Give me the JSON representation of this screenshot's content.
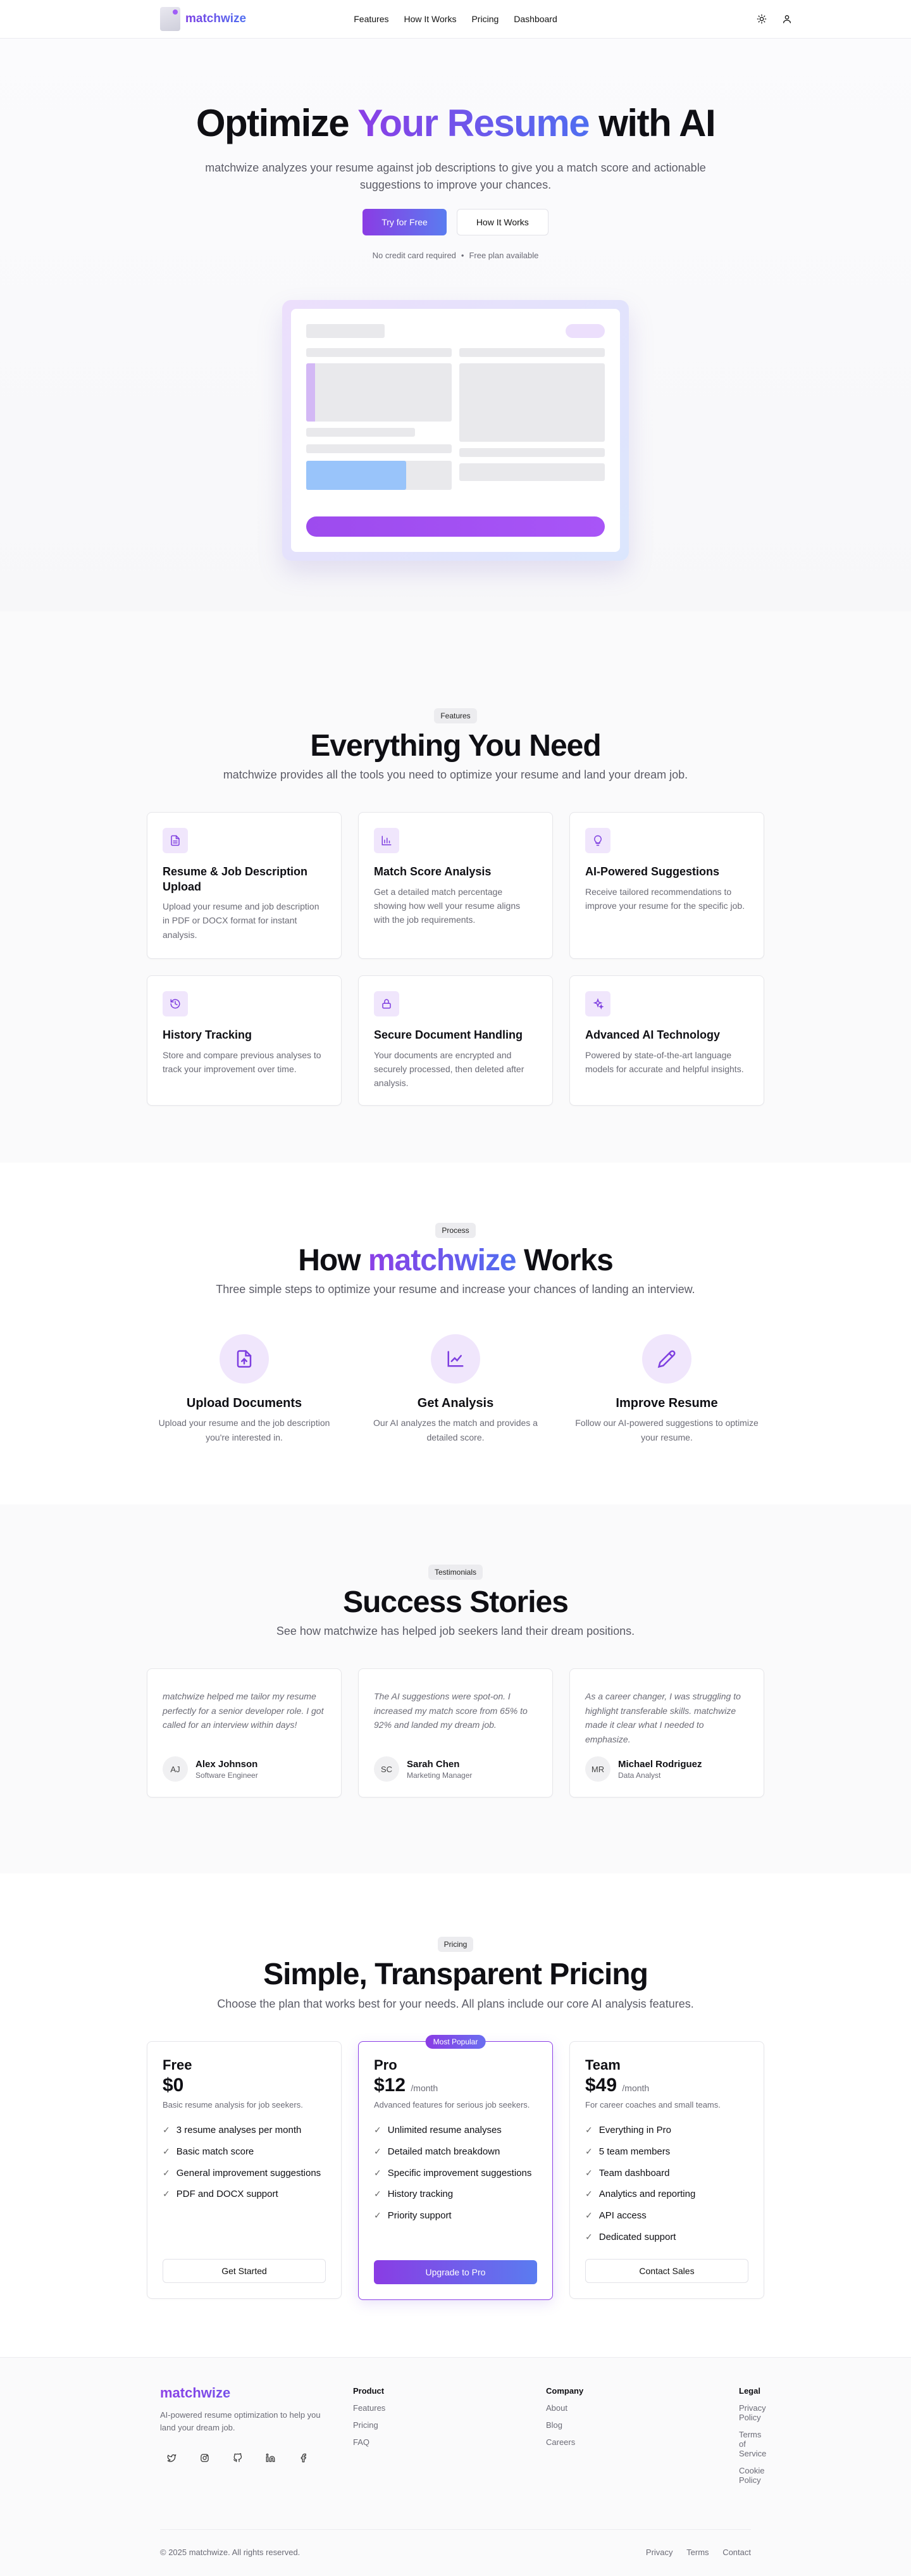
{
  "brand": {
    "name": "matchwize"
  },
  "nav": {
    "items": [
      "Features",
      "How It Works",
      "Pricing",
      "Dashboard"
    ]
  },
  "hero": {
    "title_pre": "Optimize ",
    "title_highlight": "Your Resume",
    "title_post": " with AI",
    "subtitle": "matchwize analyzes your resume against job descriptions to give you a match score and actionable suggestions to improve your chances.",
    "primary_cta": "Try for Free",
    "secondary_cta": "How It Works",
    "note_1": "No credit card required",
    "note_sep": "•",
    "note_2": "Free plan available"
  },
  "features": {
    "badge": "Features",
    "title": "Everything You Need",
    "lead": "matchwize provides all the tools you need to optimize your resume and land your dream job.",
    "items": [
      {
        "icon": "file-icon",
        "title": "Resume & Job Description Upload",
        "desc": "Upload your resume and job description in PDF or DOCX format for instant analysis."
      },
      {
        "icon": "chart-icon",
        "title": "Match Score Analysis",
        "desc": "Get a detailed match percentage showing how well your resume aligns with the job requirements."
      },
      {
        "icon": "lightbulb-icon",
        "title": "AI-Powered Suggestions",
        "desc": "Receive tailored recommendations to improve your resume for the specific job."
      },
      {
        "icon": "history-icon",
        "title": "History Tracking",
        "desc": "Store and compare previous analyses to track your improvement over time."
      },
      {
        "icon": "lock-icon",
        "title": "Secure Document Handling",
        "desc": "Your documents are encrypted and securely processed, then deleted after analysis."
      },
      {
        "icon": "sparkles-icon",
        "title": "Advanced AI Technology",
        "desc": "Powered by state-of-the-art language models for accurate and helpful insights."
      }
    ]
  },
  "how": {
    "badge": "Process",
    "title_pre": "How ",
    "title_highlight": "matchwize",
    "title_post": " Works",
    "lead": "Three simple steps to optimize your resume and increase your chances of landing an interview.",
    "steps": [
      {
        "icon": "upload-icon",
        "title": "Upload Documents",
        "desc": "Upload your resume and the job description you're interested in."
      },
      {
        "icon": "line-chart-icon",
        "title": "Get Analysis",
        "desc": "Our AI analyzes the match and provides a detailed score."
      },
      {
        "icon": "pencil-icon",
        "title": "Improve Resume",
        "desc": "Follow our AI-powered suggestions to optimize your resume."
      }
    ]
  },
  "testimonials": {
    "badge": "Testimonials",
    "title": "Success Stories",
    "lead": "See how matchwize has helped job seekers land their dream positions.",
    "items": [
      {
        "quote": "matchwize helped me tailor my resume perfectly for a senior developer role. I got called for an interview within days!",
        "initials": "AJ",
        "name": "Alex Johnson",
        "role": "Software Engineer"
      },
      {
        "quote": "The AI suggestions were spot-on. I increased my match score from 65% to 92% and landed my dream job.",
        "initials": "SC",
        "name": "Sarah Chen",
        "role": "Marketing Manager"
      },
      {
        "quote": "As a career changer, I was struggling to highlight transferable skills. matchwize made it clear what I needed to emphasize.",
        "initials": "MR",
        "name": "Michael Rodriguez",
        "role": "Data Analyst"
      }
    ]
  },
  "pricing": {
    "badge": "Pricing",
    "title": "Simple, Transparent Pricing",
    "lead": "Choose the plan that works best for your needs. All plans include our core AI analysis features.",
    "plans": [
      {
        "name": "Free",
        "price": "$0",
        "period": "",
        "desc": "Basic resume analysis for job seekers.",
        "features": [
          "3 resume analyses per month",
          "Basic match score",
          "General improvement suggestions",
          "PDF and DOCX support"
        ],
        "cta": "Get Started"
      },
      {
        "name": "Pro",
        "price": "$12",
        "period": "/month",
        "badge": "Most Popular",
        "desc": "Advanced features for serious job seekers.",
        "features": [
          "Unlimited resume analyses",
          "Detailed match breakdown",
          "Specific improvement suggestions",
          "History tracking",
          "Priority support"
        ],
        "cta": "Upgrade to Pro"
      },
      {
        "name": "Team",
        "price": "$49",
        "period": "/month",
        "desc": "For career coaches and small teams.",
        "features": [
          "Everything in Pro",
          "5 team members",
          "Team dashboard",
          "Analytics and reporting",
          "API access",
          "Dedicated support"
        ],
        "cta": "Contact Sales"
      }
    ]
  },
  "footer": {
    "tagline": "AI-powered resume optimization to help you land your dream job.",
    "socials": [
      "twitter-icon",
      "instagram-icon",
      "github-icon",
      "linkedin-icon",
      "facebook-icon"
    ],
    "columns": [
      {
        "title": "Product",
        "links": [
          "Features",
          "Pricing",
          "FAQ"
        ]
      },
      {
        "title": "Company",
        "links": [
          "About",
          "Blog",
          "Careers"
        ]
      },
      {
        "title": "Legal",
        "links": [
          "Privacy Policy",
          "Terms of Service",
          "Cookie Policy"
        ]
      }
    ],
    "copyright": "© 2025 matchwize. All rights reserved.",
    "bottom_links": [
      "Privacy",
      "Terms",
      "Contact"
    ]
  }
}
